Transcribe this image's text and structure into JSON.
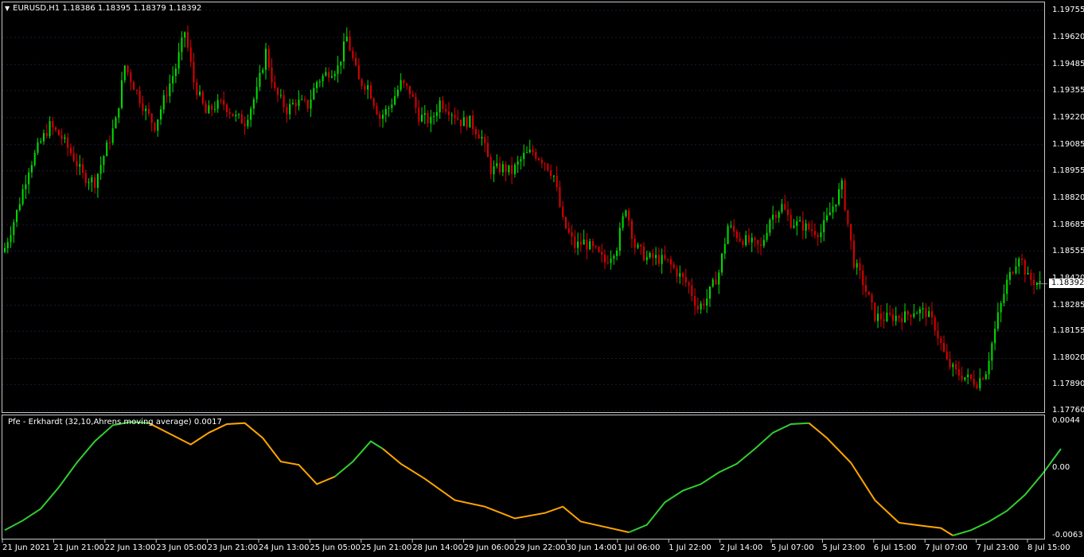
{
  "main_header": {
    "arrow": "▼",
    "symbol_text": "EURUSD,H1  1.18386 1.18395 1.18379 1.18392"
  },
  "indicator_header": {
    "text": "Pfe - Erkhardt (32,10,Ahrens moving average) 0.0017"
  },
  "current_price": "1.18392",
  "price_axis": [
    "1.19755",
    "1.19620",
    "1.19485",
    "1.19355",
    "1.19220",
    "1.19085",
    "1.18955",
    "1.18820",
    "1.18685",
    "1.18555",
    "1.18420",
    "1.18285",
    "1.18155",
    "1.18020",
    "1.17890",
    "1.17760"
  ],
  "indicator_axis": [
    "0.0044",
    "0.00",
    "-0.0063"
  ],
  "time_axis": [
    "21 Jun 2021",
    "21 Jun 21:00",
    "22 Jun 13:00",
    "23 Jun 05:00",
    "23 Jun 21:00",
    "24 Jun 13:00",
    "25 Jun 05:00",
    "25 Jun 21:00",
    "28 Jun 14:00",
    "29 Jun 06:00",
    "29 Jun 22:00",
    "30 Jun 14:00",
    "1 Jul 06:00",
    "1 Jul 22:00",
    "2 Jul 14:00",
    "5 Jul 07:00",
    "5 Jul 23:00",
    "6 Jul 15:00",
    "7 Jul 07:00",
    "7 Jul 23:00",
    "8 Jul 15:00"
  ],
  "colors": {
    "background": "#000000",
    "bull": "#00e000",
    "bear": "#e00000",
    "pfe_up": "#32cd32",
    "pfe_down": "#ffa500",
    "frame": "#c8c8c8",
    "grid": "#1a1a3a"
  },
  "chart_data": {
    "type": "candlestick",
    "symbol": "EURUSD",
    "timeframe": "H1",
    "ylim": [
      1.1776,
      1.19755
    ],
    "close_path": [
      [
        0,
        1.1857
      ],
      [
        4,
        1.1875
      ],
      [
        8,
        1.1897
      ],
      [
        12,
        1.191
      ],
      [
        15,
        1.1918
      ],
      [
        19,
        1.1912
      ],
      [
        23,
        1.1902
      ],
      [
        26,
        1.1893
      ],
      [
        30,
        1.189
      ],
      [
        33,
        1.1903
      ],
      [
        37,
        1.192
      ],
      [
        40,
        1.1948
      ],
      [
        43,
        1.1938
      ],
      [
        47,
        1.1925
      ],
      [
        50,
        1.1918
      ],
      [
        54,
        1.1935
      ],
      [
        57,
        1.1947
      ],
      [
        60,
        1.1965
      ],
      [
        63,
        1.194
      ],
      [
        67,
        1.1924
      ],
      [
        70,
        1.1928
      ],
      [
        73,
        1.1929
      ],
      [
        77,
        1.1922
      ],
      [
        80,
        1.192
      ],
      [
        84,
        1.1935
      ],
      [
        87,
        1.1955
      ],
      [
        90,
        1.1935
      ],
      [
        94,
        1.1926
      ],
      [
        97,
        1.193
      ],
      [
        101,
        1.1928
      ],
      [
        104,
        1.194
      ],
      [
        108,
        1.1945
      ],
      [
        111,
        1.1947
      ],
      [
        114,
        1.1962
      ],
      [
        118,
        1.194
      ],
      [
        121,
        1.1938
      ],
      [
        125,
        1.1922
      ],
      [
        128,
        1.1927
      ],
      [
        132,
        1.1939
      ],
      [
        135,
        1.1935
      ],
      [
        138,
        1.1923
      ],
      [
        142,
        1.192
      ],
      [
        145,
        1.193
      ],
      [
        149,
        1.1925
      ],
      [
        152,
        1.192
      ],
      [
        155,
        1.192
      ],
      [
        159,
        1.1912
      ],
      [
        162,
        1.1896
      ],
      [
        166,
        1.1897
      ],
      [
        169,
        1.1895
      ],
      [
        173,
        1.1903
      ],
      [
        176,
        1.1905
      ],
      [
        180,
        1.19
      ],
      [
        183,
        1.1893
      ],
      [
        186,
        1.187
      ],
      [
        190,
        1.1858
      ],
      [
        193,
        1.186
      ],
      [
        197,
        1.1855
      ],
      [
        200,
        1.185
      ],
      [
        204,
        1.1858
      ],
      [
        207,
        1.1878
      ],
      [
        210,
        1.1858
      ],
      [
        214,
        1.1852
      ],
      [
        217,
        1.1852
      ],
      [
        221,
        1.185
      ],
      [
        224,
        1.1845
      ],
      [
        228,
        1.1838
      ],
      [
        231,
        1.1827
      ],
      [
        234,
        1.1832
      ],
      [
        238,
        1.1845
      ],
      [
        241,
        1.1868
      ],
      [
        245,
        1.1862
      ],
      [
        248,
        1.186
      ],
      [
        252,
        1.1857
      ],
      [
        255,
        1.1872
      ],
      [
        259,
        1.1878
      ],
      [
        262,
        1.187
      ],
      [
        266,
        1.1868
      ],
      [
        269,
        1.1866
      ],
      [
        272,
        1.1865
      ],
      [
        276,
        1.1878
      ],
      [
        279,
        1.1888
      ],
      [
        283,
        1.185
      ],
      [
        286,
        1.184
      ],
      [
        290,
        1.1823
      ],
      [
        293,
        1.1822
      ],
      [
        297,
        1.1823
      ],
      [
        300,
        1.1823
      ],
      [
        303,
        1.1826
      ],
      [
        307,
        1.1825
      ],
      [
        310,
        1.1818
      ],
      [
        314,
        1.18
      ],
      [
        317,
        1.1795
      ],
      [
        321,
        1.1792
      ],
      [
        324,
        1.179
      ],
      [
        327,
        1.1796
      ],
      [
        331,
        1.1823
      ],
      [
        334,
        1.184
      ],
      [
        338,
        1.1854
      ],
      [
        341,
        1.1842
      ],
      [
        345,
        1.1839
      ]
    ],
    "pfe": {
      "type": "line",
      "ylim": [
        -0.0063,
        0.0044
      ],
      "segments": [
        {
          "trend": "up",
          "points": [
            [
              0,
              -0.0058
            ],
            [
              6,
              -0.0049
            ],
            [
              12,
              -0.0038
            ],
            [
              18,
              -0.0018
            ],
            [
              24,
              0.0005
            ],
            [
              30,
              0.0025
            ],
            [
              36,
              0.004
            ],
            [
              42,
              0.0043
            ],
            [
              48,
              0.0042
            ]
          ]
        },
        {
          "trend": "down",
          "points": [
            [
              48,
              0.0042
            ],
            [
              55,
              0.0032
            ],
            [
              62,
              0.0022
            ],
            [
              68,
              0.0033
            ],
            [
              74,
              0.0041
            ],
            [
              80,
              0.0042
            ],
            [
              86,
              0.0028
            ],
            [
              92,
              0.0006
            ],
            [
              98,
              0.0003
            ],
            [
              104,
              -0.0015
            ],
            [
              110,
              -0.0008
            ]
          ]
        },
        {
          "trend": "up",
          "points": [
            [
              110,
              -0.0008
            ],
            [
              116,
              0.0006
            ],
            [
              122,
              0.0025
            ],
            [
              126,
              0.0018
            ]
          ]
        },
        {
          "trend": "down",
          "points": [
            [
              126,
              0.0018
            ],
            [
              132,
              0.0004
            ],
            [
              140,
              -0.001
            ],
            [
              150,
              -0.003
            ],
            [
              160,
              -0.0036
            ],
            [
              170,
              -0.0047
            ],
            [
              180,
              -0.0042
            ],
            [
              186,
              -0.0036
            ],
            [
              192,
              -0.005
            ],
            [
              200,
              -0.0055
            ],
            [
              208,
              -0.006
            ]
          ]
        },
        {
          "trend": "up",
          "points": [
            [
              208,
              -0.006
            ],
            [
              214,
              -0.0053
            ],
            [
              220,
              -0.0032
            ],
            [
              226,
              -0.0021
            ],
            [
              232,
              -0.0015
            ],
            [
              238,
              -0.0004
            ],
            [
              244,
              0.0004
            ],
            [
              250,
              0.0018
            ],
            [
              256,
              0.0033
            ],
            [
              262,
              0.0041
            ],
            [
              268,
              0.0042
            ]
          ]
        },
        {
          "trend": "down",
          "points": [
            [
              268,
              0.0042
            ],
            [
              274,
              0.0028
            ],
            [
              282,
              0.0005
            ],
            [
              290,
              -0.003
            ],
            [
              298,
              -0.0051
            ],
            [
              306,
              -0.0054
            ],
            [
              312,
              -0.0056
            ],
            [
              316,
              -0.0063
            ]
          ]
        },
        {
          "trend": "up",
          "points": [
            [
              316,
              -0.0063
            ],
            [
              322,
              -0.0058
            ],
            [
              328,
              -0.005
            ],
            [
              334,
              -0.004
            ],
            [
              340,
              -0.0025
            ],
            [
              346,
              -0.0005
            ],
            [
              352,
              0.0018
            ]
          ]
        }
      ]
    }
  }
}
